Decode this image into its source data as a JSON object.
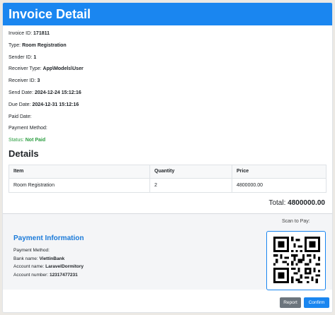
{
  "header": {
    "title": "Invoice Detail"
  },
  "invoice": {
    "id_label": "Invoice ID:",
    "id": "171811",
    "type_label": "Type:",
    "type": "Room Registration",
    "sender_label": "Sender ID:",
    "sender": "1",
    "receiver_type_label": "Receiver Type:",
    "receiver_type": "App\\Models\\User",
    "receiver_label": "Receiver ID:",
    "receiver": "3",
    "send_date_label": "Send Date:",
    "send_date": "2024-12-24 15:12:16",
    "due_date_label": "Due Date:",
    "due_date": "2024-12-31 15:12:16",
    "paid_date_label": "Paid Date:",
    "paid_date": "",
    "payment_method_label": "Payment Method:",
    "payment_method": "",
    "status_label": "Status:",
    "status": "Not Paid",
    "status_color": "#2a9d3f"
  },
  "details": {
    "title": "Details",
    "columns": [
      "Item",
      "Quantity",
      "Price"
    ],
    "rows": [
      [
        "Room Registration",
        "2",
        "4800000.00"
      ]
    ],
    "total_label": "Total:",
    "total": "4800000.00"
  },
  "payment": {
    "scan_label": "Scan to Pay:",
    "title": "Payment Information",
    "method_label": "Payment Method:",
    "bank_label": "Bank name:",
    "bank": "ViettinBank",
    "account_name_label": "Account name:",
    "account_name": "LaravelDormitory",
    "account_number_label": "Account number:",
    "account_number": "12317477231",
    "qr_icon": "qr-code-icon"
  },
  "footer": {
    "report_label": "Report",
    "confirm_label": "Confirm"
  },
  "colors": {
    "accent": "#1a86f0",
    "status_green": "#2a9d3f",
    "report_gray": "#6c757d",
    "payment_title": "#1a7ad9"
  }
}
